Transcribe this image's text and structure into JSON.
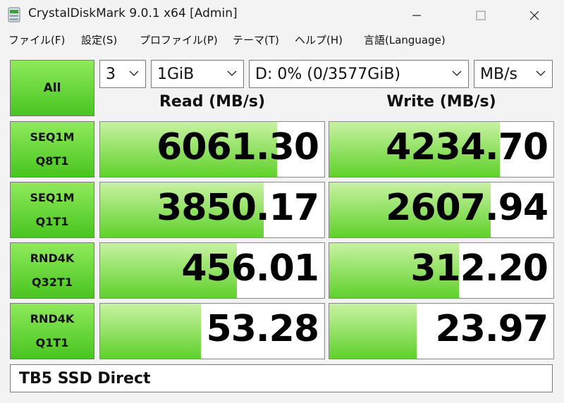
{
  "window": {
    "title": "CrystalDiskMark 9.0.1 x64 [Admin]"
  },
  "menu": [
    "ファイル(F)",
    "設定(S)",
    "プロファイル(P)",
    "テーマ(T)",
    "ヘルプ(H)",
    "言語(Language)"
  ],
  "controls": {
    "all_label": "All",
    "count": "3",
    "size": "1GiB",
    "drive": "D: 0% (0/3577GiB)",
    "unit": "MB/s"
  },
  "headers": {
    "read": "Read (MB/s)",
    "write": "Write (MB/s)"
  },
  "tests": [
    {
      "line1": "SEQ1M",
      "line2": "Q8T1",
      "read": "6061.30",
      "write": "4234.70",
      "read_fill": 0.79,
      "write_fill": 0.76
    },
    {
      "line1": "SEQ1M",
      "line2": "Q1T1",
      "read": "3850.17",
      "write": "2607.94",
      "read_fill": 0.73,
      "write_fill": 0.72
    },
    {
      "line1": "RND4K",
      "line2": "Q32T1",
      "read": "456.01",
      "write": "312.20",
      "read_fill": 0.61,
      "write_fill": 0.58
    },
    {
      "line1": "RND4K",
      "line2": "Q1T1",
      "read": "53.28",
      "write": "23.97",
      "read_fill": 0.45,
      "write_fill": 0.39
    }
  ],
  "comment": "TB5 SSD Direct",
  "colors": {
    "button_top": "#8fea5c",
    "button_bottom": "#48c51f",
    "bar_top": "#c8f2a2",
    "bar_bottom": "#5fd12b"
  }
}
